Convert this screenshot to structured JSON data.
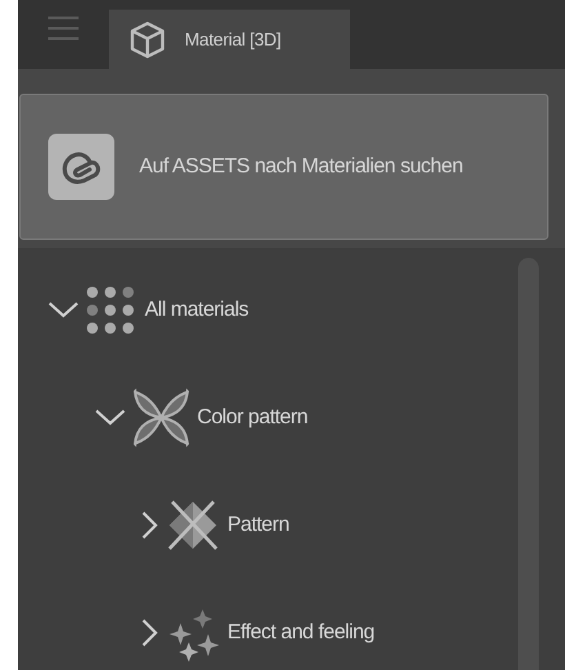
{
  "tabs": [
    {
      "label": "Material [3D]",
      "selected": true
    }
  ],
  "assets_button": {
    "label": "Auf ASSETS nach Materialien suchen"
  },
  "tree": [
    {
      "label": "All materials",
      "expanded": true,
      "children": [
        {
          "label": "Color pattern",
          "expanded": true,
          "children": [
            {
              "label": "Pattern",
              "expanded": false
            },
            {
              "label": "Effect and feeling",
              "expanded": false
            }
          ]
        }
      ]
    }
  ]
}
